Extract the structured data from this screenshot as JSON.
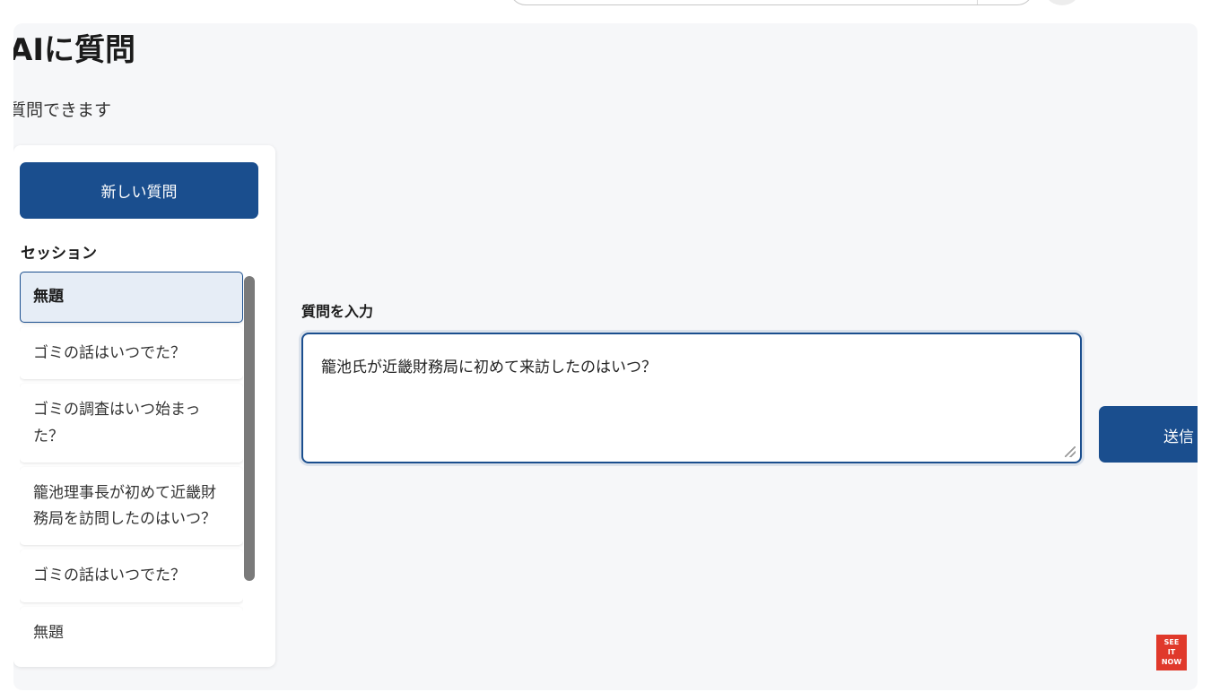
{
  "header": {
    "title": "AIに質問",
    "subtitle": "質問できます"
  },
  "sidebar": {
    "new_question_label": "新しい質問",
    "session_heading": "セッション",
    "sessions": [
      {
        "label": "無題",
        "active": true
      },
      {
        "label": "ゴミの話はいつでた？"
      },
      {
        "label": "ゴミの調査はいつ始まった？"
      },
      {
        "label": "籠池理事長が初めて近畿財務局を訪問したのはいつ？"
      },
      {
        "label": "ゴミの話はいつでた？"
      },
      {
        "label": "無題"
      }
    ]
  },
  "main": {
    "input_label": "質問を入力",
    "input_value": "籠池氏が近畿財務局に初めて来訪したのはいつ？",
    "send_label": "送信"
  },
  "badge": {
    "line1": "SEE",
    "line2": "IT",
    "line3": "NOW"
  },
  "colors": {
    "primary": "#1a4e8e",
    "background": "#f6f7f9",
    "badge": "#e0392b"
  }
}
